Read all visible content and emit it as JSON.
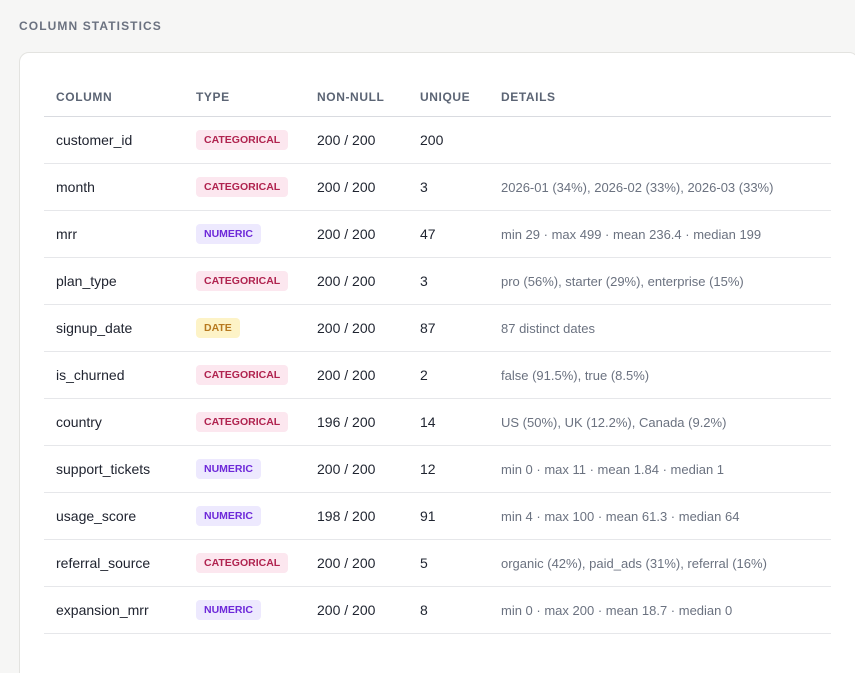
{
  "section": {
    "title": "COLUMN STATISTICS"
  },
  "table": {
    "headers": {
      "column": "COLUMN",
      "type": "TYPE",
      "non_null": "NON-NULL",
      "unique": "UNIQUE",
      "details": "DETAILS"
    },
    "rows": [
      {
        "column": "customer_id",
        "type": "CATEGORICAL",
        "type_key": "categorical",
        "non_null": "200 / 200",
        "unique": "200",
        "details": ""
      },
      {
        "column": "month",
        "type": "CATEGORICAL",
        "type_key": "categorical",
        "non_null": "200 / 200",
        "unique": "3",
        "details": "2026-01 (34%), 2026-02 (33%), 2026-03 (33%)"
      },
      {
        "column": "mrr",
        "type": "NUMERIC",
        "type_key": "numeric",
        "non_null": "200 / 200",
        "unique": "47",
        "details": "min 29 · max 499 · mean 236.4 · median 199"
      },
      {
        "column": "plan_type",
        "type": "CATEGORICAL",
        "type_key": "categorical",
        "non_null": "200 / 200",
        "unique": "3",
        "details": "pro (56%), starter (29%), enterprise (15%)"
      },
      {
        "column": "signup_date",
        "type": "DATE",
        "type_key": "date",
        "non_null": "200 / 200",
        "unique": "87",
        "details": "87 distinct dates"
      },
      {
        "column": "is_churned",
        "type": "CATEGORICAL",
        "type_key": "categorical",
        "non_null": "200 / 200",
        "unique": "2",
        "details": "false (91.5%), true (8.5%)"
      },
      {
        "column": "country",
        "type": "CATEGORICAL",
        "type_key": "categorical",
        "non_null": "196 / 200",
        "unique": "14",
        "details": "US (50%), UK (12.2%), Canada (9.2%)"
      },
      {
        "column": "support_tickets",
        "type": "NUMERIC",
        "type_key": "numeric",
        "non_null": "200 / 200",
        "unique": "12",
        "details": "min 0 · max 11 · mean 1.84 · median 1"
      },
      {
        "column": "usage_score",
        "type": "NUMERIC",
        "type_key": "numeric",
        "non_null": "198 / 200",
        "unique": "91",
        "details": "min 4 · max 100 · mean 61.3 · median 64"
      },
      {
        "column": "referral_source",
        "type": "CATEGORICAL",
        "type_key": "categorical",
        "non_null": "200 / 200",
        "unique": "5",
        "details": "organic (42%), paid_ads (31%), referral (16%)"
      },
      {
        "column": "expansion_mrr",
        "type": "NUMERIC",
        "type_key": "numeric",
        "non_null": "200 / 200",
        "unique": "8",
        "details": "min 0 · max 200 · mean 18.7 · median 0"
      }
    ]
  }
}
